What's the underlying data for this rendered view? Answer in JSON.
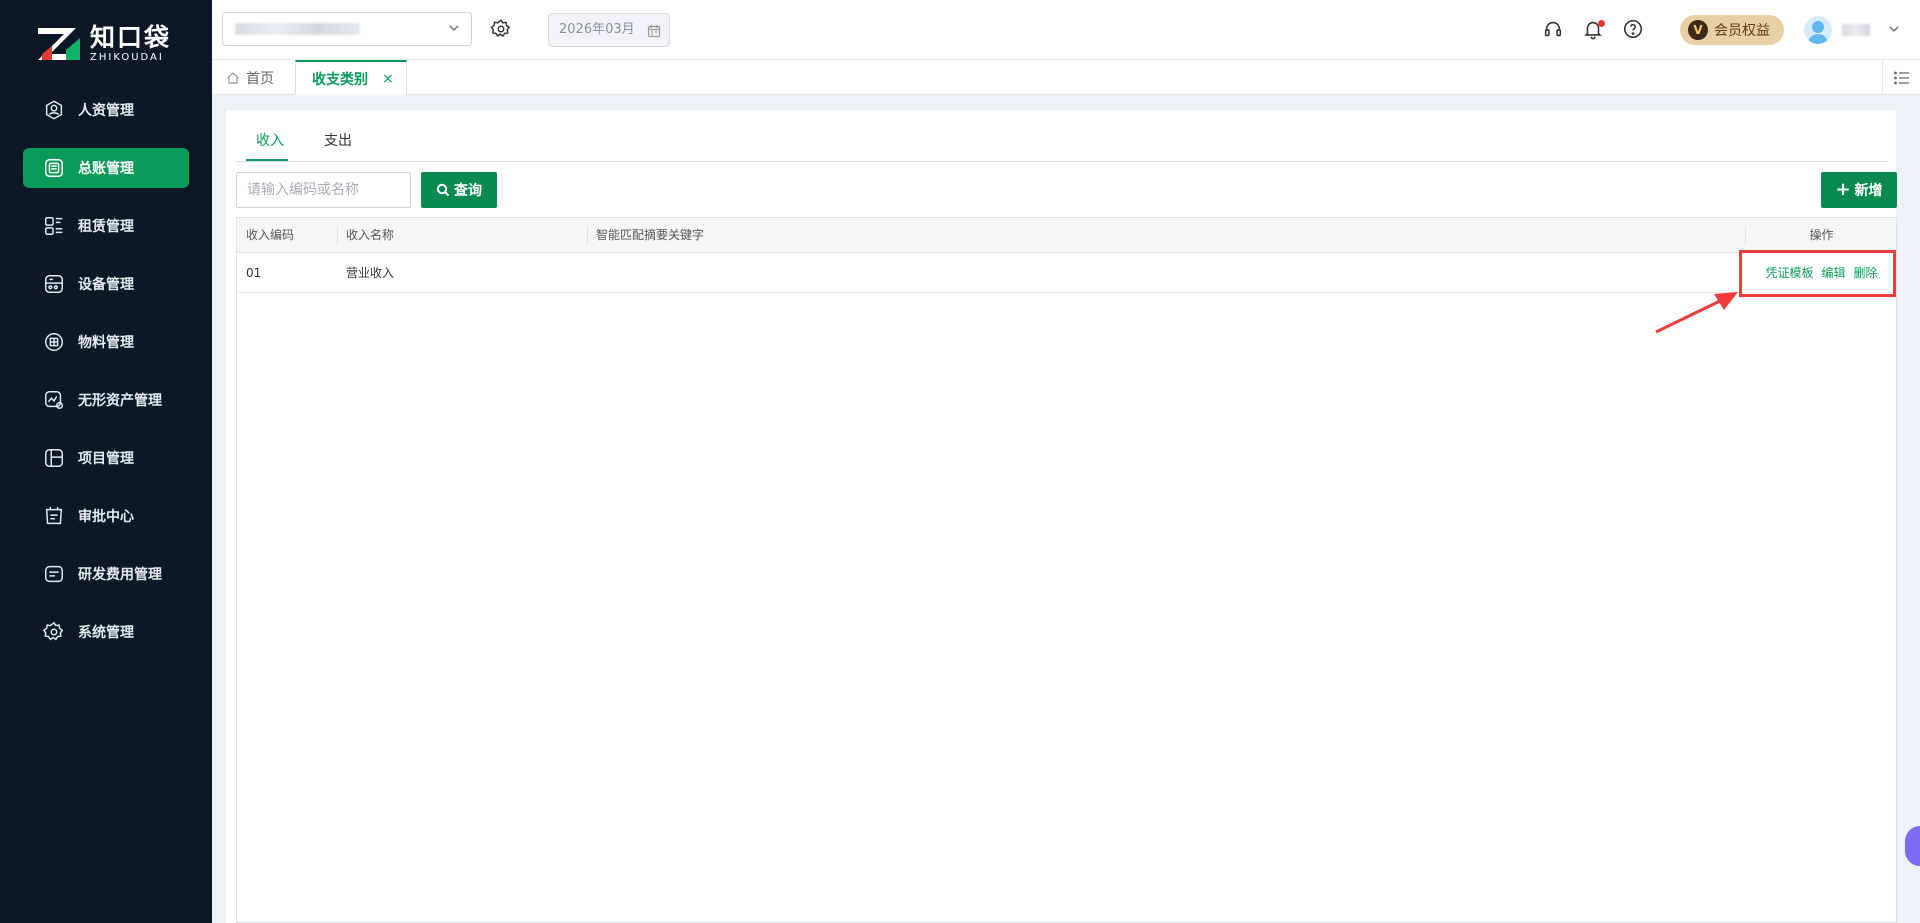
{
  "logo": {
    "cn": "知口袋",
    "en": "ZHIKOUDAI"
  },
  "sidebar": {
    "items": [
      {
        "label": "人资管理",
        "icon": "person-icon",
        "active": false
      },
      {
        "label": "总账管理",
        "icon": "ledger-icon",
        "active": true
      },
      {
        "label": "租赁管理",
        "icon": "lease-icon",
        "active": false
      },
      {
        "label": "设备管理",
        "icon": "device-icon",
        "active": false
      },
      {
        "label": "物料管理",
        "icon": "material-icon",
        "active": false
      },
      {
        "label": "无形资产管理",
        "icon": "intangible-icon",
        "active": false
      },
      {
        "label": "项目管理",
        "icon": "project-icon",
        "active": false
      },
      {
        "label": "审批中心",
        "icon": "approval-icon",
        "active": false
      },
      {
        "label": "研发费用管理",
        "icon": "rd-icon",
        "active": false
      },
      {
        "label": "系统管理",
        "icon": "gear-icon",
        "active": false
      }
    ]
  },
  "header": {
    "date": "2026年03月",
    "vip_label": "会员权益",
    "vip_badge": "V"
  },
  "tabs": {
    "home": "首页",
    "active": "收支类别",
    "close": "×"
  },
  "subtabs": {
    "income": "收入",
    "expense": "支出"
  },
  "toolbar": {
    "search_placeholder": "请输入编码或名称",
    "query_label": "查询",
    "add_label": "新增"
  },
  "table": {
    "columns": [
      "收入编码",
      "收入名称",
      "智能匹配摘要关键字",
      "操作"
    ],
    "rows": [
      {
        "code": "01",
        "name": "营业收入",
        "keywords": ""
      }
    ],
    "actions": [
      "凭证模板",
      "编辑",
      "删除"
    ]
  },
  "colors": {
    "brand": "#0a9b5a",
    "sidebar_bg": "#0e1726",
    "highlight": "#ee3b3b"
  }
}
